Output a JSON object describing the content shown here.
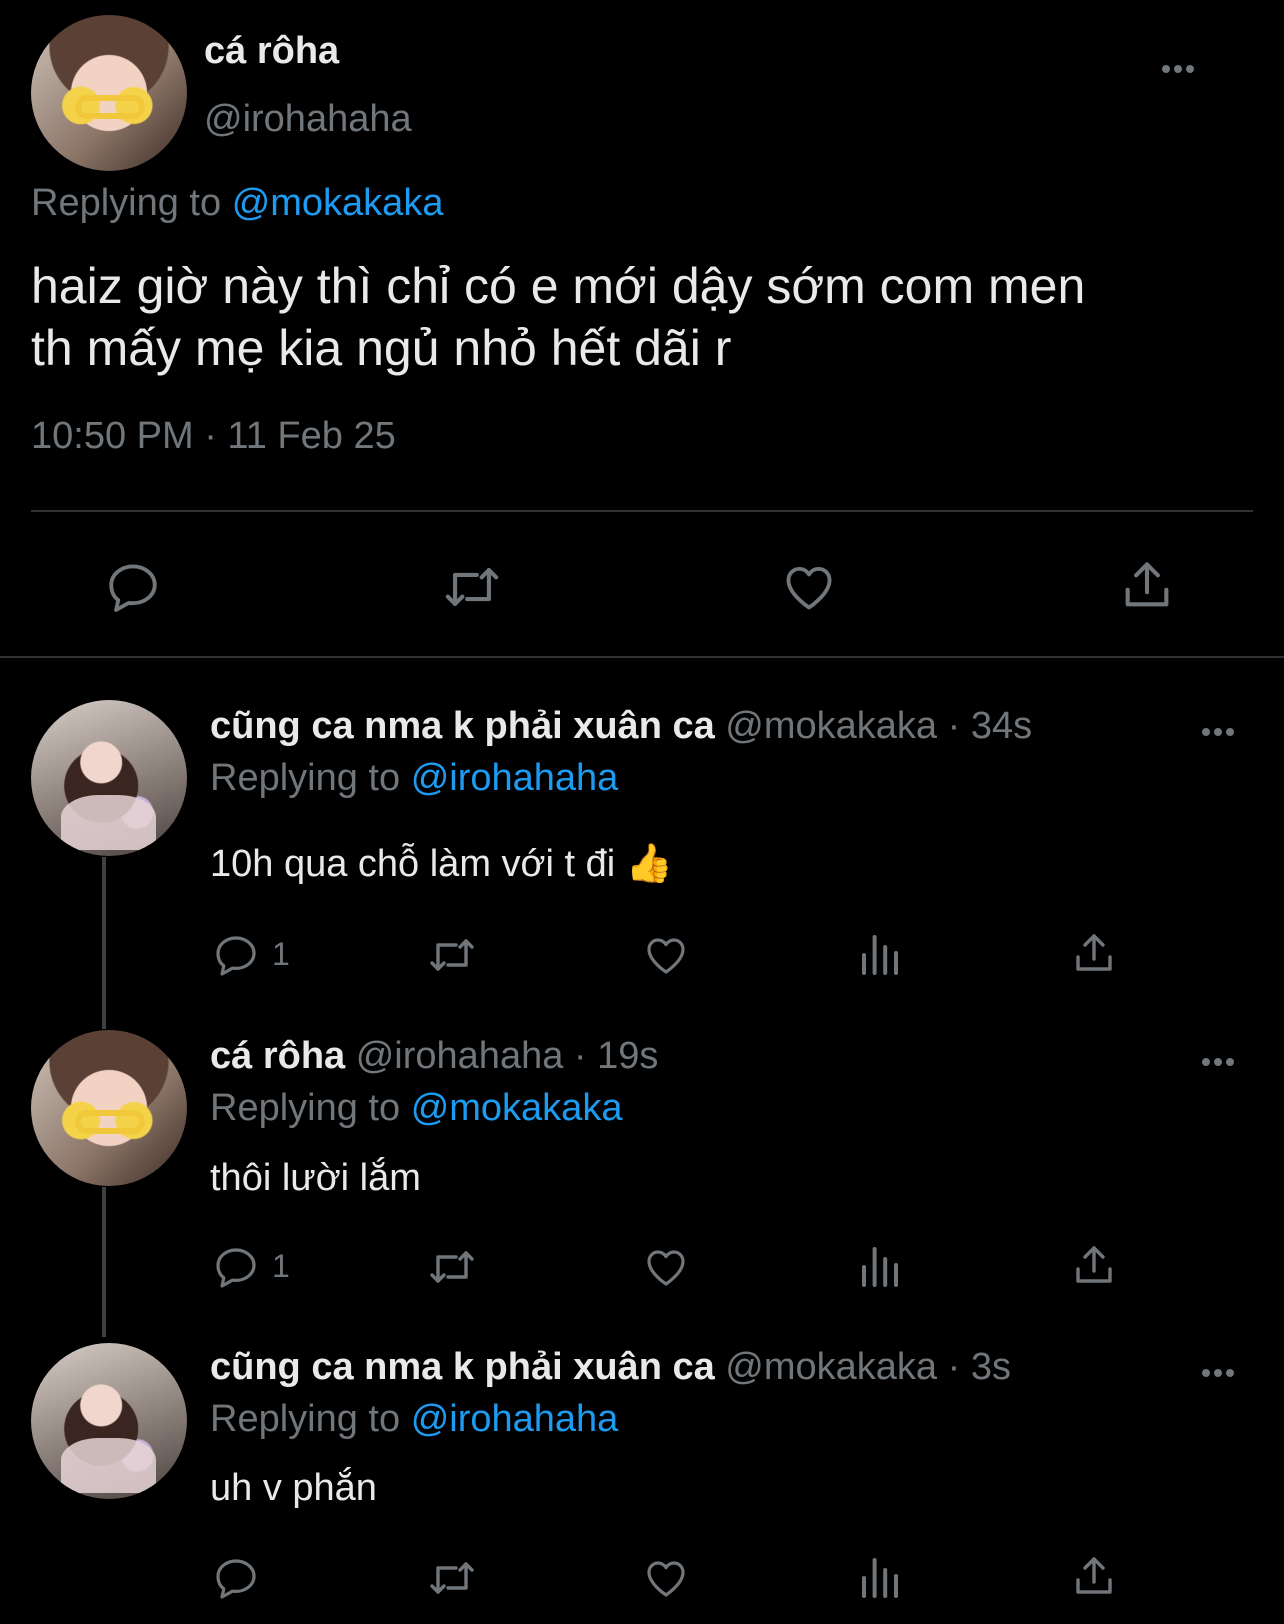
{
  "main_tweet": {
    "display_name": "cá rôha",
    "handle": "@irohahaha",
    "replying_label": "Replying to",
    "replying_to": "@mokakaka",
    "text_line1": "haiz giờ này thì chỉ có e mới dậy sớm com men",
    "text_line2": "th mấy mẹ kia ngủ nhỏ hết dãi r",
    "timestamp": "10:50 PM · 11 Feb 25"
  },
  "replies": [
    {
      "display_name": "cũng ca nma k phải xuân ca",
      "meta": "@mokakaka · 34s",
      "replying_label": "Replying to",
      "replying_to": "@irohahaha",
      "text": "10h qua chỗ làm với t đi 👍",
      "reply_count": "1"
    },
    {
      "display_name": "cá rôha",
      "meta": "@irohahaha · 19s",
      "replying_label": "Replying to",
      "replying_to": "@mokakaka",
      "text": "thôi lười lắm",
      "reply_count": "1"
    },
    {
      "display_name": "cũng ca nma k phải xuân ca",
      "meta": "@mokakaka · 3s",
      "replying_label": "Replying to",
      "replying_to": "@irohahaha",
      "text": "uh v phắn",
      "reply_count": ""
    }
  ],
  "colors": {
    "background": "#000000",
    "text": "#e7e9ea",
    "muted": "#71767b",
    "link": "#1d9bf0",
    "divider": "#2f3336"
  },
  "icons": [
    "reply-icon",
    "retweet-icon",
    "like-icon",
    "views-icon",
    "share-icon",
    "more-icon"
  ]
}
